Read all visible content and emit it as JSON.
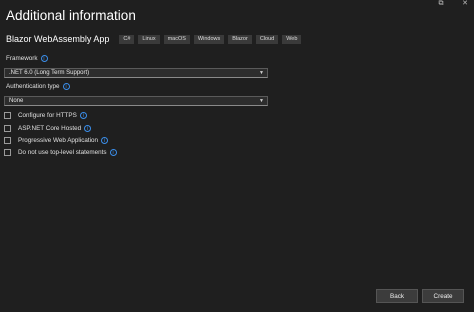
{
  "window": {
    "title": "Additional information",
    "controls": [
      "⧉",
      "✕"
    ]
  },
  "template": {
    "name": "Blazor WebAssembly App",
    "tags": [
      "C#",
      "Linux",
      "macOS",
      "Windows",
      "Blazor",
      "Cloud",
      "Web"
    ]
  },
  "framework": {
    "label": "Framework",
    "value": ".NET 6.0 (Long Term Support)"
  },
  "authentication": {
    "label": "Authentication type",
    "value": "None"
  },
  "options": [
    {
      "label": "Configure for HTTPS",
      "checked": false,
      "info": true
    },
    {
      "label": "ASP.NET Core Hosted",
      "checked": false,
      "info": true
    },
    {
      "label": "Progressive Web Application",
      "checked": false,
      "info": true
    },
    {
      "label": "Do not use top-level statements",
      "checked": false,
      "info": true
    }
  ],
  "buttons": {
    "back": "Back",
    "create": "Create"
  },
  "icons": {
    "info": "info-icon",
    "dropdown": "chevron-down-icon"
  },
  "colors": {
    "background": "#1f1f1f",
    "accent": "#3b8eea"
  }
}
